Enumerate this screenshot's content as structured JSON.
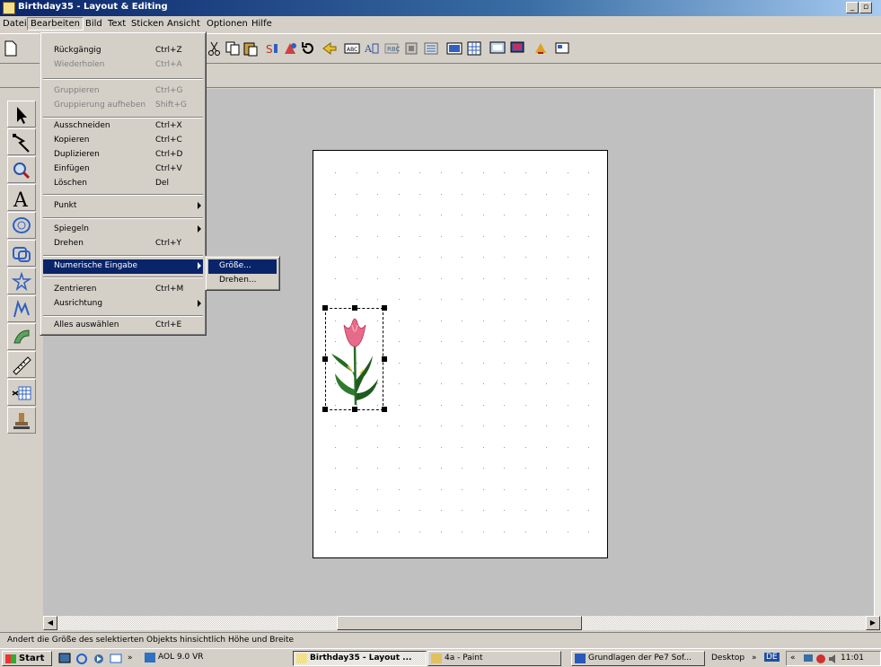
{
  "window": {
    "title": "Birthday35 - Layout & Editing"
  },
  "menubar": [
    "Datei",
    "Bearbeiten",
    "Bild",
    "Text",
    "Sticken",
    "Ansicht",
    "Optionen",
    "Hilfe"
  ],
  "edit_menu": {
    "items": [
      {
        "label": "Rückgängig",
        "shortcut": "Ctrl+Z"
      },
      {
        "label": "Wiederholen",
        "shortcut": "Ctrl+A"
      },
      {
        "label": "Gruppieren",
        "shortcut": "Ctrl+G"
      },
      {
        "label": "Gruppierung aufheben",
        "shortcut": "Shift+G"
      },
      {
        "label": "Ausschneiden",
        "shortcut": "Ctrl+X"
      },
      {
        "label": "Kopieren",
        "shortcut": "Ctrl+C"
      },
      {
        "label": "Duplizieren",
        "shortcut": "Ctrl+D"
      },
      {
        "label": "Einfügen",
        "shortcut": "Ctrl+V"
      },
      {
        "label": "Löschen",
        "shortcut": "Del"
      },
      {
        "label": "Punkt",
        "shortcut": ""
      },
      {
        "label": "Spiegeln",
        "shortcut": ""
      },
      {
        "label": "Drehen",
        "shortcut": "Ctrl+Y"
      },
      {
        "label": "Numerische Eingabe",
        "shortcut": ""
      },
      {
        "label": "Zentrieren",
        "shortcut": "Ctrl+M"
      },
      {
        "label": "Ausrichtung",
        "shortcut": ""
      },
      {
        "label": "Alles auswählen",
        "shortcut": "Ctrl+E"
      }
    ]
  },
  "numeric_submenu": {
    "items": [
      "Größe...",
      "Drehen..."
    ]
  },
  "statusbar": {
    "text": "Andert die Größe des selektierten Objekts hinsichtlich Höhe und Breite"
  },
  "taskbar": {
    "start": "Start",
    "tasks": [
      "AOL 9.0 VR",
      "Birthday35 - Layout ...",
      "4a - Paint",
      "Grundlagen der Pe7 Sof..."
    ],
    "desktop": "Desktop",
    "lang": "DE",
    "clock": "11:01"
  },
  "colors": {
    "titlebar": "#0a246a",
    "highlight": "#0a246a",
    "workarea": "#c0c0c0"
  }
}
